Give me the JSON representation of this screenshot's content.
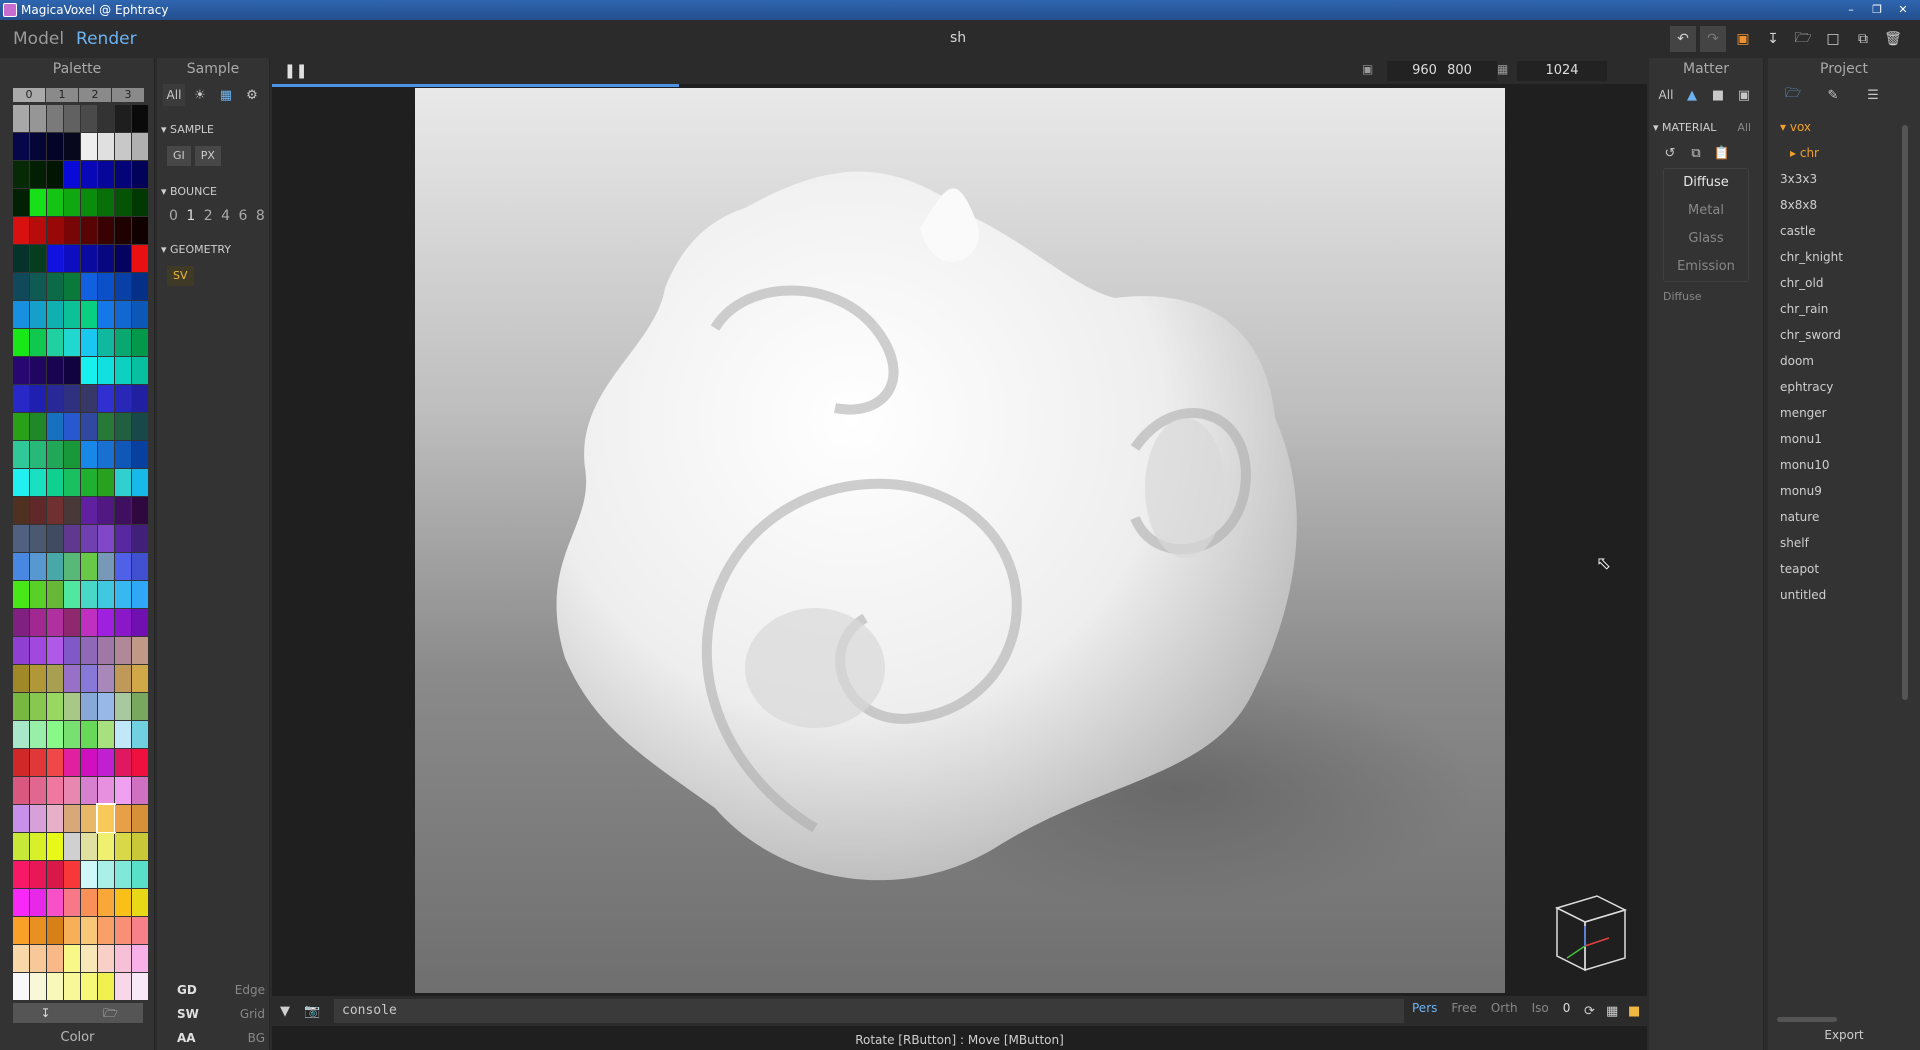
{
  "window": {
    "title": "MagicaVoxel @ Ephtracy"
  },
  "topbar": {
    "model_label": "Model",
    "render_label": "Render",
    "project_name": "sh"
  },
  "palette": {
    "title": "Palette",
    "tabs": [
      "0",
      "1",
      "2",
      "3"
    ],
    "colors": [
      "#a8a8a8",
      "#969696",
      "#7a7a7a",
      "#616161",
      "#4a4a4a",
      "#333333",
      "#1e1e1e",
      "#0a0a0a",
      "#06064a",
      "#050536",
      "#040428",
      "#08081c",
      "#eeeeee",
      "#e0e0e0",
      "#c8c8c8",
      "#b0b0b0",
      "#052a05",
      "#031f03",
      "#021402",
      "#0a0ad8",
      "#0808b8",
      "#060698",
      "#040478",
      "#020258",
      "#022002",
      "#18e018",
      "#14c414",
      "#10a810",
      "#0c8c0c",
      "#087008",
      "#055405",
      "#023802",
      "#d81010",
      "#b80c0c",
      "#980808",
      "#780606",
      "#580404",
      "#380202",
      "#200101",
      "#100000",
      "#05322a",
      "#063d1f",
      "#1212e0",
      "#0e0ec0",
      "#0a0aa0",
      "#070780",
      "#040460",
      "#e81010",
      "#104a5a",
      "#0f5a52",
      "#0c6a48",
      "#0a7a3a",
      "#1060e0",
      "#0a50c8",
      "#0840a8",
      "#063088",
      "#1890e0",
      "#14a0c8",
      "#10b0b0",
      "#0cc098",
      "#08d080",
      "#1478e8",
      "#1068d0",
      "#0c58b8",
      "#18e818",
      "#10c850",
      "#20d0a0",
      "#20d8d0",
      "#18c8f0",
      "#10b8a0",
      "#08a870",
      "#04984a",
      "#280870",
      "#200660",
      "#180450",
      "#100340",
      "#18f0f0",
      "#10e0e0",
      "#0cd0c0",
      "#08c0a0",
      "#2828c8",
      "#2020b0",
      "#282898",
      "#303080",
      "#383868",
      "#3030d0",
      "#2828b8",
      "#2020a0",
      "#28a018",
      "#208828",
      "#1870c0",
      "#2858d0",
      "#3048a0",
      "#287838",
      "#206040",
      "#184848",
      "#30c898",
      "#28b878",
      "#20a858",
      "#189838",
      "#1888e8",
      "#1870d0",
      "#1058b8",
      "#0840a0",
      "#20f0f0",
      "#18e0c0",
      "#10d090",
      "#18c060",
      "#20b030",
      "#28a020",
      "#30d0d0",
      "#18b8e8",
      "#503020",
      "#602828",
      "#703030",
      "#483838",
      "#6020a0",
      "#501880",
      "#401060",
      "#300840",
      "#506080",
      "#4a5870",
      "#404a60",
      "#603890",
      "#7040b0",
      "#8048c8",
      "#5828a0",
      "#402078",
      "#4888e0",
      "#5898d0",
      "#48a8a8",
      "#58b878",
      "#68c848",
      "#7898b8",
      "#5060e8",
      "#4050d0",
      "#48e818",
      "#58d028",
      "#68b838",
      "#50e8a0",
      "#48d8c8",
      "#40c8e0",
      "#38b8f0",
      "#30a8f8",
      "#802080",
      "#a02890",
      "#b030a0",
      "#902870",
      "#c030c0",
      "#a020e0",
      "#8818c8",
      "#7010b0",
      "#9040d0",
      "#a048e0",
      "#b058e8",
      "#8058c8",
      "#9068b8",
      "#a078a8",
      "#b08898",
      "#c09888",
      "#a08828",
      "#b09838",
      "#a8a050",
      "#9870c8",
      "#8878d8",
      "#a888b8",
      "#c09858",
      "#d0a848",
      "#78b840",
      "#88c850",
      "#98d860",
      "#a8c888",
      "#88a8d8",
      "#98b8e8",
      "#a8c8a0",
      "#78a860",
      "#a8e8c8",
      "#98f0a8",
      "#88f888",
      "#78e070",
      "#68d858",
      "#a8e080",
      "#c0e8f8",
      "#70d0e0",
      "#d02828",
      "#e03838",
      "#f04848",
      "#e020a0",
      "#d010c0",
      "#c020d0",
      "#e01860",
      "#f01040",
      "#d85880",
      "#e06890",
      "#f078a0",
      "#e888b0",
      "#d880d0",
      "#e890e0",
      "#f0a0f0",
      "#d070c0",
      "#c890e8",
      "#d8a0d8",
      "#e8b0c8",
      "#d8a878",
      "#e8b868",
      "#f8c858",
      "#e8a048",
      "#d89038",
      "#c8e838",
      "#d8f028",
      "#e8f818",
      "#d0d0d0",
      "#e0e0a0",
      "#f0f070",
      "#d8d848",
      "#c8c838",
      "#f81868",
      "#e81858",
      "#d81848",
      "#f83838",
      "#d0f8f8",
      "#a8f0e8",
      "#80e8d8",
      "#58e0c8",
      "#f828f8",
      "#e828e8",
      "#f850c8",
      "#f87888",
      "#f89058",
      "#f8a838",
      "#f8c018",
      "#e8d818",
      "#f8a028",
      "#e89020",
      "#d88018",
      "#f8b058",
      "#f8c878",
      "#f8a068",
      "#f89078",
      "#f88088",
      "#f8d8a8",
      "#f8c898",
      "#f8b888",
      "#f8f888",
      "#f8e8b8",
      "#f8d0c8",
      "#f8c0d8",
      "#f8b0e8",
      "#f8f8f8",
      "#f8f8d8",
      "#f8f8b8",
      "#f8f898",
      "#f8f878",
      "#f0f050",
      "#f8d8e8",
      "#f8e8f8"
    ],
    "bottom_left_icon": "import-icon",
    "bottom_right_icon": "open-folder-icon",
    "footer": "Color"
  },
  "sample": {
    "title": "Sample",
    "all_label": "All",
    "section_sample": "SAMPLE",
    "sample_btns": [
      "GI",
      "PX"
    ],
    "section_bounce": "BOUNCE",
    "bounces": [
      "0",
      "1",
      "2",
      "4",
      "6",
      "8"
    ],
    "section_geometry": "GEOMETRY",
    "geometry_btn": "SV",
    "lower": [
      {
        "k": "GD",
        "v": "Edge"
      },
      {
        "k": "SW",
        "v": "Grid"
      },
      {
        "k": "AA",
        "v": "BG"
      }
    ]
  },
  "viewport": {
    "resolution_w": "960",
    "resolution_h": "800",
    "samples": "1024",
    "progress": 0.33,
    "console_text": "console",
    "views": [
      "Pers",
      "Free",
      "Orth",
      "Iso"
    ],
    "view_active": "Pers",
    "view_num": "0",
    "status": "Rotate [RButton] : Move [MButton]"
  },
  "matter": {
    "title": "Matter",
    "all_label": "All",
    "section": "MATERIAL",
    "section_all": "All",
    "materials": [
      "Diffuse",
      "Metal",
      "Glass",
      "Emission"
    ],
    "active": "Diffuse",
    "current": "Diffuse"
  },
  "project": {
    "title": "Project",
    "root": "vox",
    "sub": "chr",
    "files": [
      "3x3x3",
      "8x8x8",
      "castle",
      "chr_knight",
      "chr_old",
      "chr_rain",
      "chr_sword",
      "doom",
      "ephtracy",
      "menger",
      "monu1",
      "monu10",
      "monu9",
      "nature",
      "shelf",
      "teapot",
      "untitled"
    ],
    "export": "Export"
  }
}
